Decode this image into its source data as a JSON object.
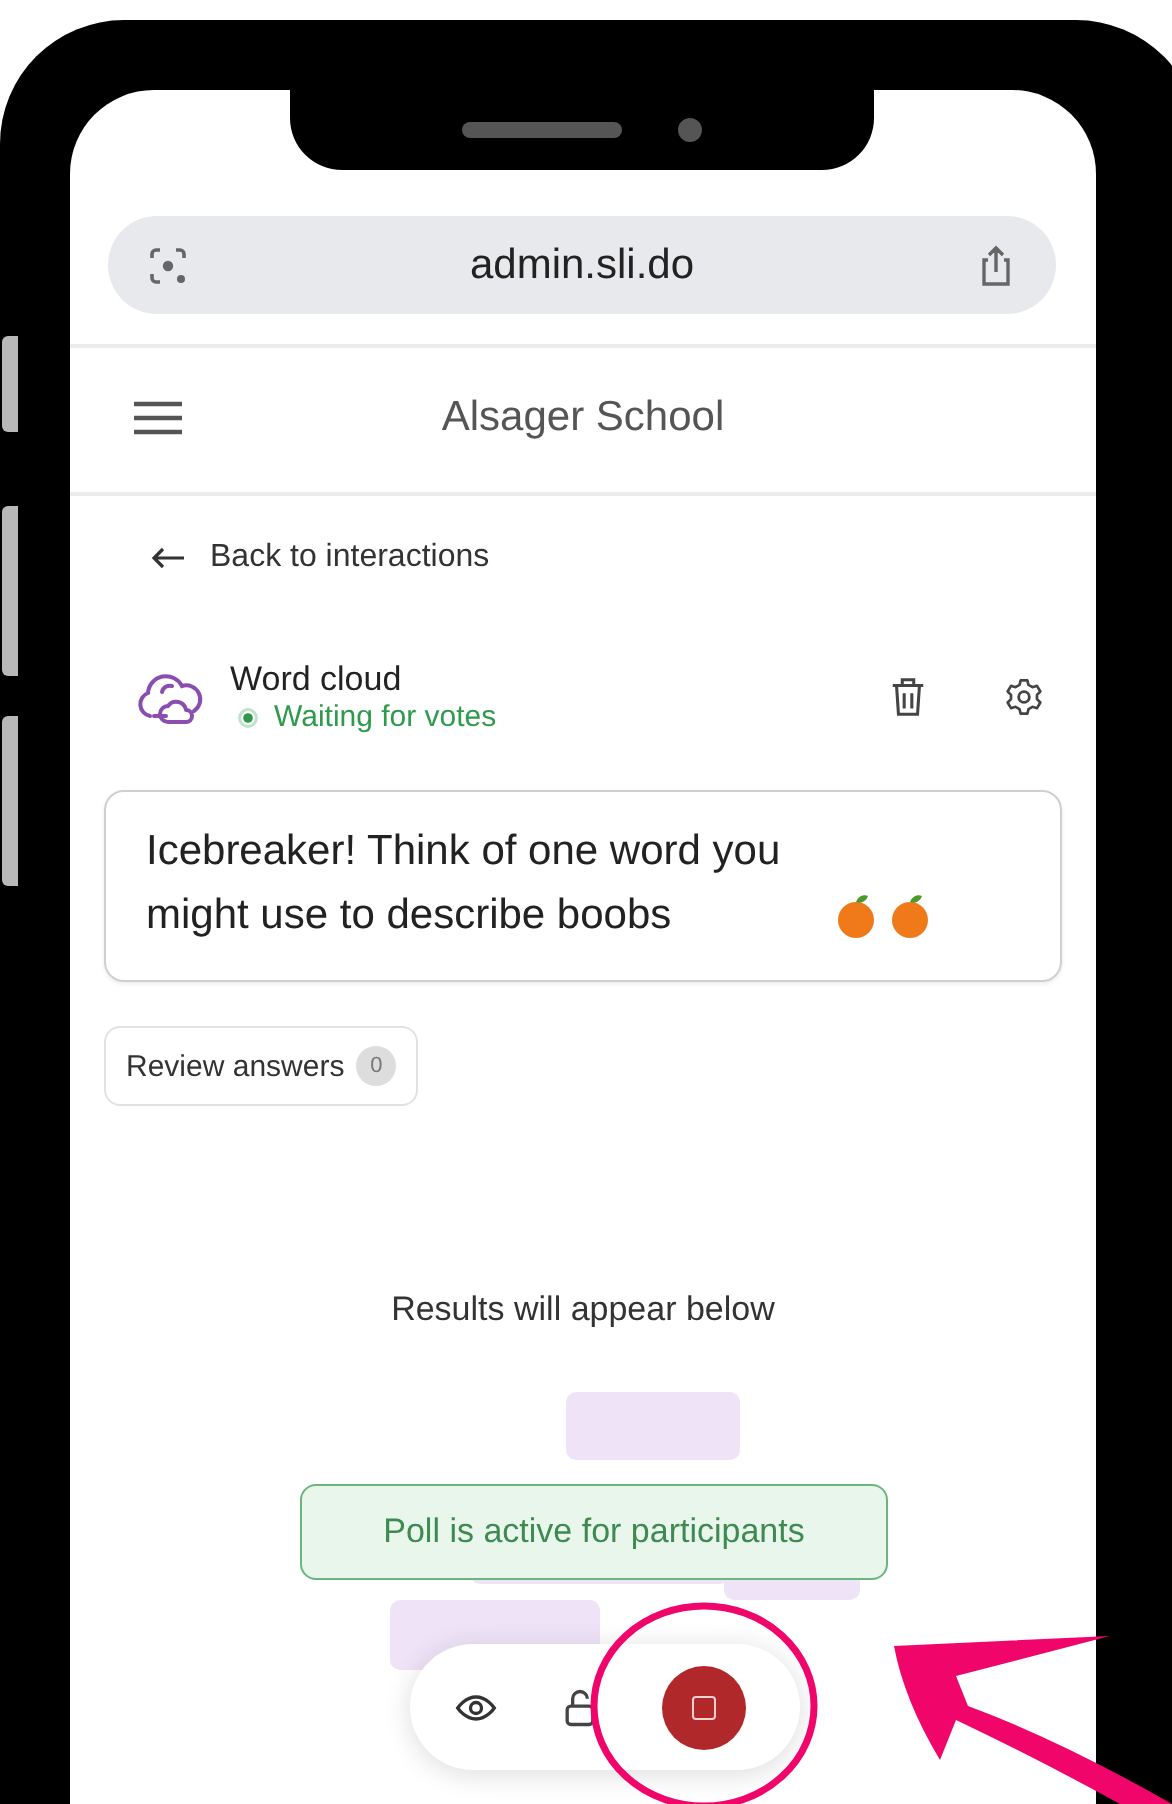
{
  "browser": {
    "url": "admin.sli.do"
  },
  "header": {
    "title": "Alsager School"
  },
  "back_link": {
    "label": "Back to interactions"
  },
  "interaction": {
    "type": "Word cloud",
    "status": "Waiting for votes",
    "question": "Icebreaker! Think of one word you might use to describe boobs"
  },
  "review": {
    "label": "Review answers",
    "count": "0"
  },
  "results": {
    "hint": "Results will appear below"
  },
  "toast": {
    "message": "Poll is active for participants"
  }
}
